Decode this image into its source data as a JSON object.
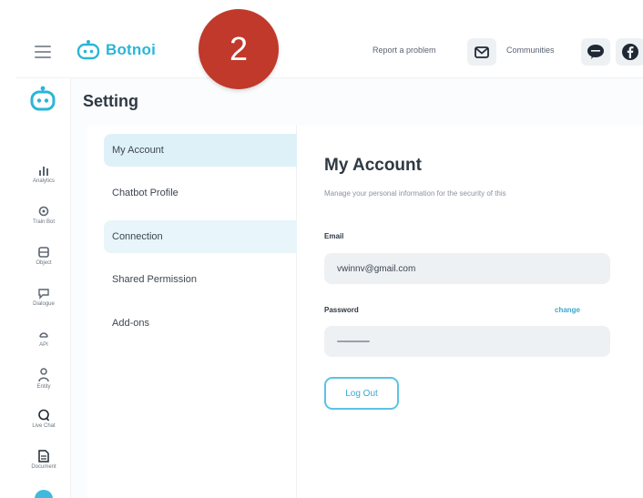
{
  "annotation": {
    "step_number": "2",
    "color": "#c0392b"
  },
  "header": {
    "brand": "Botnoi",
    "brand_color": "#29b6d8",
    "report_label": "Report a problem",
    "communities_label": "Communities",
    "icons": [
      "menu-icon",
      "botnoi-logo",
      "mail-icon",
      "line-icon",
      "facebook-icon"
    ]
  },
  "rail": {
    "items": [
      {
        "label": "Analytics",
        "icon": "analytics-icon"
      },
      {
        "label": "Train Bot",
        "icon": "train-bot-icon"
      },
      {
        "label": "Object",
        "icon": "object-icon"
      },
      {
        "label": "Dialogue",
        "icon": "dialogue-icon"
      },
      {
        "label": "API",
        "icon": "api-icon"
      },
      {
        "label": "Entity",
        "icon": "entity-icon"
      },
      {
        "label": "Live Chat",
        "icon": "live-chat-icon"
      },
      {
        "label": "Document",
        "icon": "document-icon"
      }
    ]
  },
  "page": {
    "title": "Setting"
  },
  "settings_menu": {
    "items": [
      {
        "label": "My Account",
        "active": true
      },
      {
        "label": "Chatbot Profile",
        "active": false
      },
      {
        "label": "Connection",
        "active": false
      },
      {
        "label": "Shared Permission",
        "active": false
      },
      {
        "label": "Add-ons",
        "active": false
      }
    ]
  },
  "account": {
    "title": "My Account",
    "subtitle": "Manage your personal information for the security of this",
    "email_label": "Email",
    "email_value": "vwinnv@gmail.com",
    "password_label": "Password",
    "change_label": "change",
    "logout_label": "Log Out"
  },
  "colors": {
    "accent": "#3aa9cf",
    "active_menu": "#dff1f8",
    "input_bg": "#eef1f4"
  }
}
